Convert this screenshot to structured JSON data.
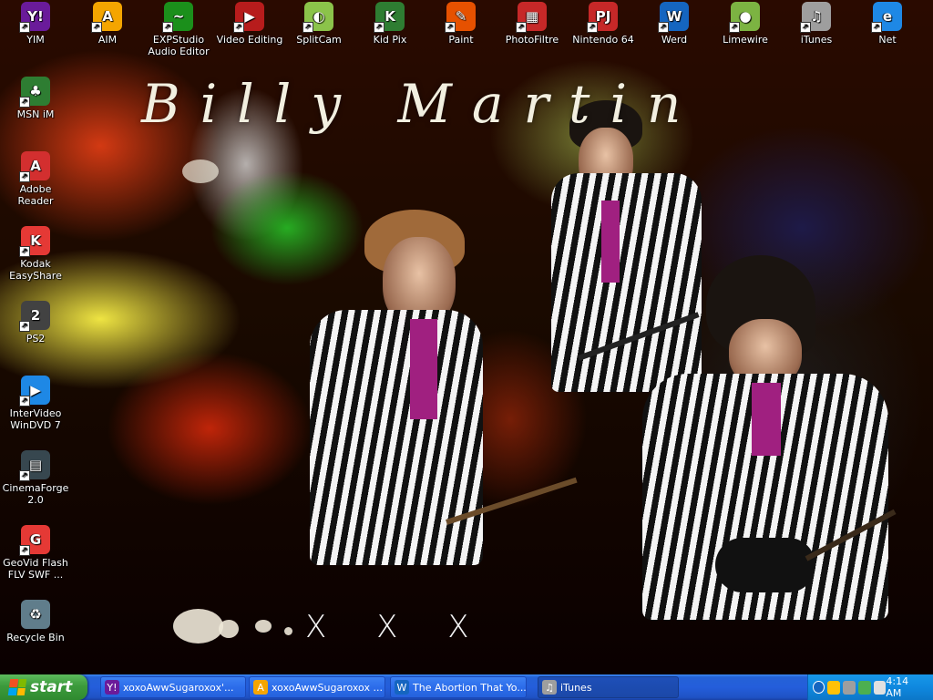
{
  "wallpaper": {
    "title": "Billy Martin",
    "marks": "X X X"
  },
  "desktop_icons": [
    {
      "name": "yim",
      "label": "YIM",
      "icon": "yahoo-messenger-icon",
      "color": "#6a1b9a"
    },
    {
      "name": "aim",
      "label": "AIM",
      "icon": "aim-running-man-icon",
      "color": "#f4a500"
    },
    {
      "name": "exp-studio",
      "label": "EXPStudio Audio Editor",
      "icon": "audio-editor-icon",
      "color": "#1b8f1b"
    },
    {
      "name": "video-editing",
      "label": "Video Editing",
      "icon": "video-editing-icon",
      "color": "#b71c1c"
    },
    {
      "name": "splitcam",
      "label": "SplitCam",
      "icon": "splitcam-icon",
      "color": "#8bc34a"
    },
    {
      "name": "kidpix",
      "label": "Kid Pix",
      "icon": "kid-pix-icon",
      "color": "#2e7d32"
    },
    {
      "name": "paint",
      "label": "Paint",
      "icon": "paint-icon",
      "color": "#e65100"
    },
    {
      "name": "photofiltre",
      "label": "PhotoFiltre",
      "icon": "photofiltre-icon",
      "color": "#c62828"
    },
    {
      "name": "nintendo64",
      "label": "Nintendo 64",
      "icon": "project64-icon",
      "color": "#c62828"
    },
    {
      "name": "werd",
      "label": "Werd",
      "icon": "werd-icon",
      "color": "#1565c0"
    },
    {
      "name": "limewire",
      "label": "Limewire",
      "icon": "limewire-icon",
      "color": "#7cb342"
    },
    {
      "name": "itunes",
      "label": "iTunes",
      "icon": "itunes-icon",
      "color": "#9e9e9e"
    },
    {
      "name": "net",
      "label": "Net",
      "icon": "internet-explorer-icon",
      "color": "#1e88e5"
    },
    {
      "name": "msn",
      "label": "MSN iM",
      "icon": "msn-messenger-icon",
      "color": "#2e7d32"
    },
    {
      "name": "adobe-reader",
      "label": "Adobe Reader",
      "icon": "adobe-reader-icon",
      "color": "#d32f2f"
    },
    {
      "name": "kodak",
      "label": "Kodak EasyShare",
      "icon": "kodak-icon",
      "color": "#e53935"
    },
    {
      "name": "ps2",
      "label": "PS2",
      "icon": "ps2-icon",
      "color": "#424242"
    },
    {
      "name": "interwideo",
      "label": "InterVideo WinDVD 7",
      "icon": "windvd-icon",
      "color": "#1e88e5"
    },
    {
      "name": "cinemaforge",
      "label": "CinemaForge 2.0",
      "icon": "cinemaforge-icon",
      "color": "#37474f"
    },
    {
      "name": "geovid",
      "label": "GeoVid Flash FLV SWF ...",
      "icon": "geovid-icon",
      "color": "#e53935"
    },
    {
      "name": "recycle-bin",
      "label": "Recycle Bin",
      "icon": "recycle-bin-icon",
      "color": "#607d8b"
    }
  ],
  "taskbar": {
    "start_label": "start",
    "tasks": [
      {
        "label": "xoxoAwwSugaroxox'...",
        "icon": "yahoo-messenger-icon",
        "color": "#6a1b9a"
      },
      {
        "label": "xoxoAwwSugaroxox ...",
        "icon": "aim-running-man-icon",
        "color": "#f4a500"
      },
      {
        "label": "The Abortion That Yo...",
        "icon": "werd-icon",
        "color": "#1565c0"
      },
      {
        "label": "iTunes",
        "icon": "itunes-icon",
        "color": "#9e9e9e"
      }
    ],
    "clock": "4:14 AM",
    "tray_icons": [
      "network-icon",
      "volume-icon",
      "messenger-status-icon",
      "user-icon"
    ]
  }
}
